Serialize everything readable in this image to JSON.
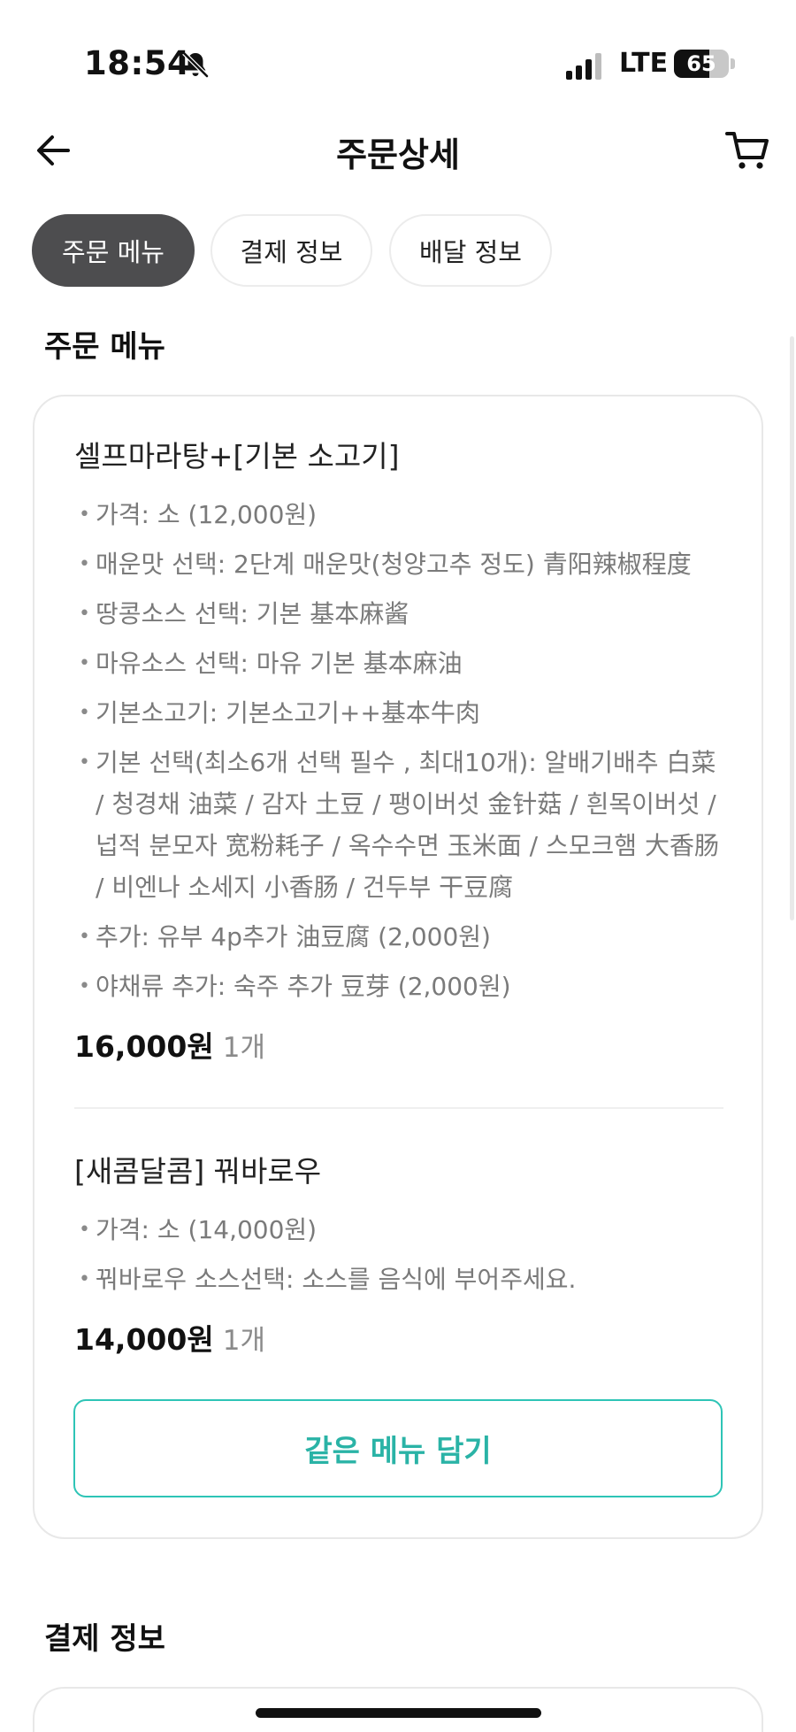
{
  "status_bar": {
    "time": "18:54",
    "network": "LTE",
    "battery": "65",
    "battery_level": 0.65
  },
  "header": {
    "title": "주문상세",
    "back_icon": "arrow-left-icon",
    "cart_icon": "cart-icon"
  },
  "tabs": [
    {
      "label": "주문 메뉴",
      "active": true
    },
    {
      "label": "결제 정보",
      "active": false
    },
    {
      "label": "배달 정보",
      "active": false
    }
  ],
  "order_section": {
    "title": "주문 메뉴",
    "items": [
      {
        "name": "셀프마라탕+[기본 소고기]",
        "options": [
          "가격: 소 (12,000원)",
          "매운맛 선택: 2단계 매운맛(청양고추 정도) 青阳辣椒程度",
          "땅콩소스 선택: 기본 基本麻酱",
          "마유소스 선택: 마유 기본 基本麻油",
          "기본소고기: 기본소고기++基本牛肉",
          "기본 선택(최소6개 선택 필수 , 최대10개): 알배기배추 白菜 / 청경채 油菜 / 감자 土豆 / 팽이버섯 金针菇 / 흰목이버섯 / 넙적 분모자 宽粉耗子 / 옥수수면 玉米面 / 스모크햄 大香肠 / 비엔나 소세지 小香肠 / 건두부 干豆腐",
          "추가: 유부 4p추가 油豆腐 (2,000원)",
          "야채류 추가: 숙주 추가 豆芽 (2,000원)"
        ],
        "price": "16,000원",
        "quantity": "1개"
      },
      {
        "name": "[새콤달콤] 꿔바로우",
        "options": [
          "가격: 소 (14,000원)",
          "꿔바로우 소스선택: 소스를 음식에 부어주세요."
        ],
        "price": "14,000원",
        "quantity": "1개"
      }
    ],
    "same_menu_button": "같은 메뉴 담기"
  },
  "payment_section": {
    "title": "결제 정보"
  },
  "colors": {
    "accent": "#2ec4b6",
    "active_tab": "#4d4d4f"
  }
}
